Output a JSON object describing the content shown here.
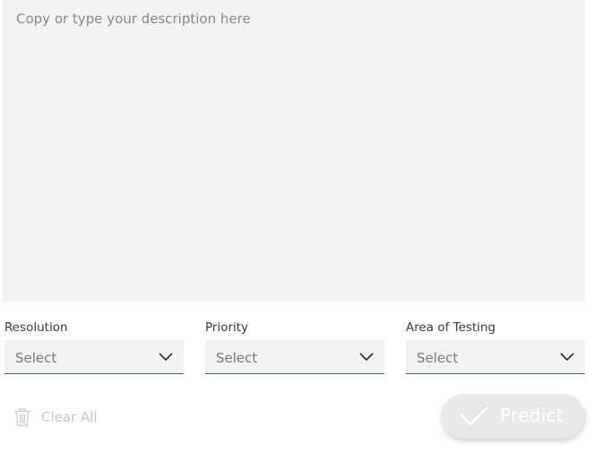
{
  "description": {
    "placeholder": "Copy or type your description here",
    "value": ""
  },
  "filters": [
    {
      "label": "Resolution",
      "value": "Select",
      "icon": "chevron-down-icon"
    },
    {
      "label": "Priority",
      "value": "Select",
      "icon": "chevron-down-icon"
    },
    {
      "label": "Area of Testing",
      "value": "Select",
      "icon": "chevron-down-icon"
    }
  ],
  "actions": {
    "clear_label": "Clear All",
    "clear_icon": "trash-icon",
    "predict_label": "Predict",
    "predict_icon": "checkmark-icon"
  },
  "colors": {
    "field_background": "#f2f2f2",
    "select_underline": "#3d6a8f",
    "predict_background": "#e8e8e8",
    "predict_text": "#ffffff",
    "disabled_text": "#c7c7c7"
  }
}
